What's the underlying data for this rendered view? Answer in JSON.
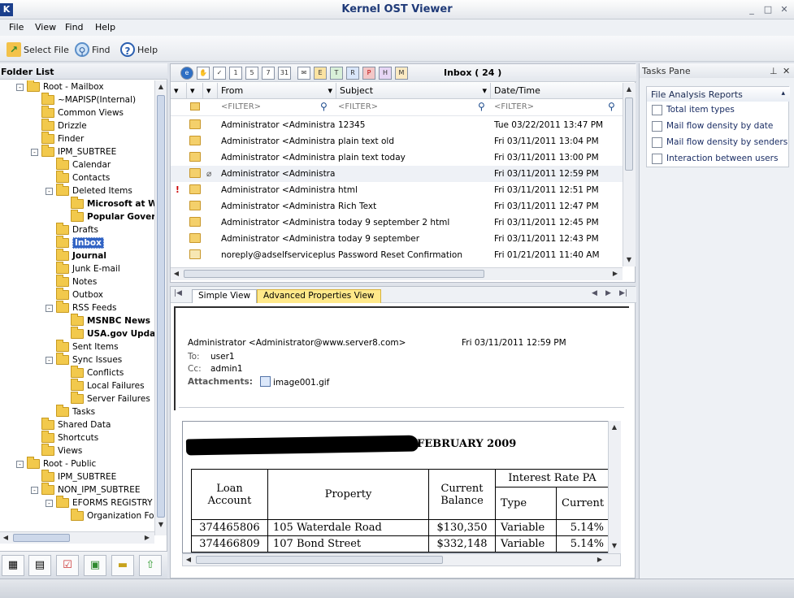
{
  "window": {
    "title": "Kernel OST Viewer",
    "logo": "K",
    "minimize": "_",
    "maximize": "□",
    "close": "✕"
  },
  "menu": [
    "File",
    "View",
    "Find",
    "Help"
  ],
  "toolbar": {
    "select_file": "Select File",
    "find": "Find",
    "help": "Help"
  },
  "folder_panel": {
    "title": "Folder List",
    "tree": [
      {
        "label": "Root - Mailbox",
        "level": 1,
        "exp": "-",
        "bold": false
      },
      {
        "label": "~MAPISP(Internal)",
        "level": 2,
        "exp": "",
        "bold": false
      },
      {
        "label": "Common Views",
        "level": 2,
        "exp": "",
        "bold": false
      },
      {
        "label": "Drizzle",
        "level": 2,
        "exp": "",
        "bold": false
      },
      {
        "label": "Finder",
        "level": 2,
        "exp": "",
        "bold": false
      },
      {
        "label": "IPM_SUBTREE",
        "level": 2,
        "exp": "-",
        "bold": false
      },
      {
        "label": "Calendar",
        "level": 3,
        "exp": "",
        "bold": false
      },
      {
        "label": "Contacts",
        "level": 3,
        "exp": "",
        "bold": false
      },
      {
        "label": "Deleted Items",
        "level": 3,
        "exp": "-",
        "bold": false
      },
      {
        "label": "Microsoft at W",
        "level": 4,
        "exp": "",
        "bold": true
      },
      {
        "label": "Popular Gover",
        "level": 4,
        "exp": "",
        "bold": true
      },
      {
        "label": "Drafts",
        "level": 3,
        "exp": "",
        "bold": false
      },
      {
        "label": "Inbox",
        "level": 3,
        "exp": "",
        "bold": true,
        "selected": true
      },
      {
        "label": "Journal",
        "level": 3,
        "exp": "",
        "bold": true
      },
      {
        "label": "Junk E-mail",
        "level": 3,
        "exp": "",
        "bold": false
      },
      {
        "label": "Notes",
        "level": 3,
        "exp": "",
        "bold": false
      },
      {
        "label": "Outbox",
        "level": 3,
        "exp": "",
        "bold": false
      },
      {
        "label": "RSS Feeds",
        "level": 3,
        "exp": "-",
        "bold": false
      },
      {
        "label": "MSNBC News",
        "level": 4,
        "exp": "",
        "bold": true
      },
      {
        "label": "USA.gov Updat",
        "level": 4,
        "exp": "",
        "bold": true
      },
      {
        "label": "Sent Items",
        "level": 3,
        "exp": "",
        "bold": false
      },
      {
        "label": "Sync Issues",
        "level": 3,
        "exp": "-",
        "bold": false
      },
      {
        "label": "Conflicts",
        "level": 4,
        "exp": "",
        "bold": false
      },
      {
        "label": "Local Failures",
        "level": 4,
        "exp": "",
        "bold": false
      },
      {
        "label": "Server Failures",
        "level": 4,
        "exp": "",
        "bold": false
      },
      {
        "label": "Tasks",
        "level": 3,
        "exp": "",
        "bold": false
      },
      {
        "label": "Shared Data",
        "level": 2,
        "exp": "",
        "bold": false
      },
      {
        "label": "Shortcuts",
        "level": 2,
        "exp": "",
        "bold": false
      },
      {
        "label": "Views",
        "level": 2,
        "exp": "",
        "bold": false
      },
      {
        "label": "Root - Public",
        "level": 1,
        "exp": "-",
        "bold": false
      },
      {
        "label": "IPM_SUBTREE",
        "level": 2,
        "exp": "",
        "bold": false
      },
      {
        "label": "NON_IPM_SUBTREE",
        "level": 2,
        "exp": "-",
        "bold": false
      },
      {
        "label": "EFORMS REGISTRY",
        "level": 3,
        "exp": "-",
        "bold": false
      },
      {
        "label": "Organization Forr",
        "level": 4,
        "exp": "",
        "bold": false
      }
    ],
    "bottom_icons": [
      "calendar-icon",
      "contacts-icon",
      "tasks-icon",
      "journal-icon",
      "notes-icon",
      "up-icon"
    ]
  },
  "message_list": {
    "folder_label": "Inbox ( 24 )",
    "columns": {
      "from": "From",
      "subject": "Subject",
      "datetime": "Date/Time"
    },
    "filter_placeholder": "<FILTER>",
    "rows": [
      {
        "from": "Administrator <Administrator...",
        "subject": "12345",
        "date": "Tue 03/22/2011 13:47 PM",
        "read": false,
        "flag": false,
        "attach": false
      },
      {
        "from": "Administrator <Administrator...",
        "subject": "plain text old",
        "date": "Fri 03/11/2011 13:04 PM",
        "read": false,
        "flag": false,
        "attach": false
      },
      {
        "from": "Administrator <Administrator...",
        "subject": "plain text today",
        "date": "Fri 03/11/2011 13:00 PM",
        "read": false,
        "flag": false,
        "attach": false
      },
      {
        "from": "Administrator <Administrator...",
        "subject": "",
        "date": "Fri 03/11/2011 12:59 PM",
        "read": false,
        "flag": false,
        "attach": true
      },
      {
        "from": "Administrator <Administrator...",
        "subject": "html",
        "date": "Fri 03/11/2011 12:51 PM",
        "read": false,
        "flag": true,
        "attach": false
      },
      {
        "from": "Administrator <Administrator...",
        "subject": "Rich Text",
        "date": "Fri 03/11/2011 12:47 PM",
        "read": false,
        "flag": false,
        "attach": false
      },
      {
        "from": "Administrator <Administrator...",
        "subject": "today 9 september 2 html",
        "date": "Fri 03/11/2011 12:45 PM",
        "read": false,
        "flag": false,
        "attach": false
      },
      {
        "from": "Administrator <Administrator...",
        "subject": "today 9 september",
        "date": "Fri 03/11/2011 12:43 PM",
        "read": false,
        "flag": false,
        "attach": false
      },
      {
        "from": "noreply@adselfserviceplus....",
        "subject": "Password Reset Confirmation",
        "date": "Fri 01/21/2011 11:40 AM",
        "read": true,
        "flag": false,
        "attach": false
      }
    ]
  },
  "preview": {
    "tabs": {
      "simple": "Simple View",
      "advanced": "Advanced Properties View"
    },
    "from": "Administrator <Administrator@www.server8.com>",
    "date": "Fri 03/11/2011 12:59 PM",
    "to_label": "To:",
    "to": "user1",
    "cc_label": "Cc:",
    "cc": "admin1",
    "attach_label": "Attachments:",
    "attachment": "image001.gif",
    "report_title": "FEBRUARY 2009",
    "table": {
      "h_loan": "Loan Account",
      "h_property": "Property",
      "h_balance": "Current Balance",
      "h_rate": "Interest Rate PA",
      "h_type": "Type",
      "h_current": "Current",
      "rows": [
        {
          "account": "374465806",
          "property": "105 Waterdale Road",
          "balance": "$130,350",
          "type": "Variable",
          "current": "5.14%"
        },
        {
          "account": "374466809",
          "property": "107 Bond Street",
          "balance": "$332,148",
          "type": "Variable",
          "current": "5.14%"
        }
      ]
    }
  },
  "tasks_pane": {
    "title": "Tasks Pane",
    "section": "File Analysis Reports",
    "items": [
      "Total item types",
      "Mail flow density by date",
      "Mail flow density by senders",
      "Interaction between users"
    ]
  }
}
